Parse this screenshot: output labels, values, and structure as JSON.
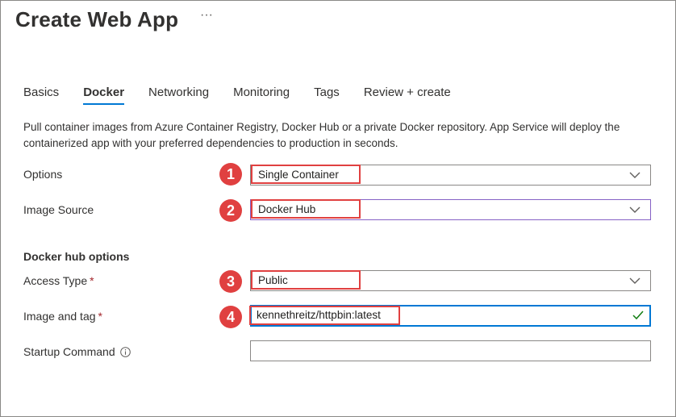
{
  "page": {
    "title": "Create Web App",
    "more_label": "···"
  },
  "tabs": [
    {
      "label": "Basics",
      "active": false
    },
    {
      "label": "Docker",
      "active": true
    },
    {
      "label": "Networking",
      "active": false
    },
    {
      "label": "Monitoring",
      "active": false
    },
    {
      "label": "Tags",
      "active": false
    },
    {
      "label": "Review + create",
      "active": false
    }
  ],
  "description": "Pull container images from Azure Container Registry, Docker Hub or a private Docker repository. App Service will deploy the containerized app with your preferred dependencies to production in seconds.",
  "form": {
    "options": {
      "label": "Options",
      "value": "Single Container",
      "badge": "1"
    },
    "image_source": {
      "label": "Image Source",
      "value": "Docker Hub",
      "badge": "2"
    },
    "section_title": "Docker hub options",
    "access_type": {
      "label": "Access Type",
      "required": "*",
      "value": "Public",
      "badge": "3"
    },
    "image_tag": {
      "label": "Image and tag",
      "required": "*",
      "value": "kennethreitz/httpbin:latest",
      "badge": "4"
    },
    "startup_command": {
      "label": "Startup Command",
      "value": ""
    }
  },
  "colors": {
    "accent": "#0078d4",
    "highlight": "#e04040",
    "valid_check": "#107c10",
    "required": "#a4262c"
  },
  "icons": {
    "dropdown": "chevron-down-icon",
    "valid": "checkmark-icon",
    "info": "info-icon"
  }
}
